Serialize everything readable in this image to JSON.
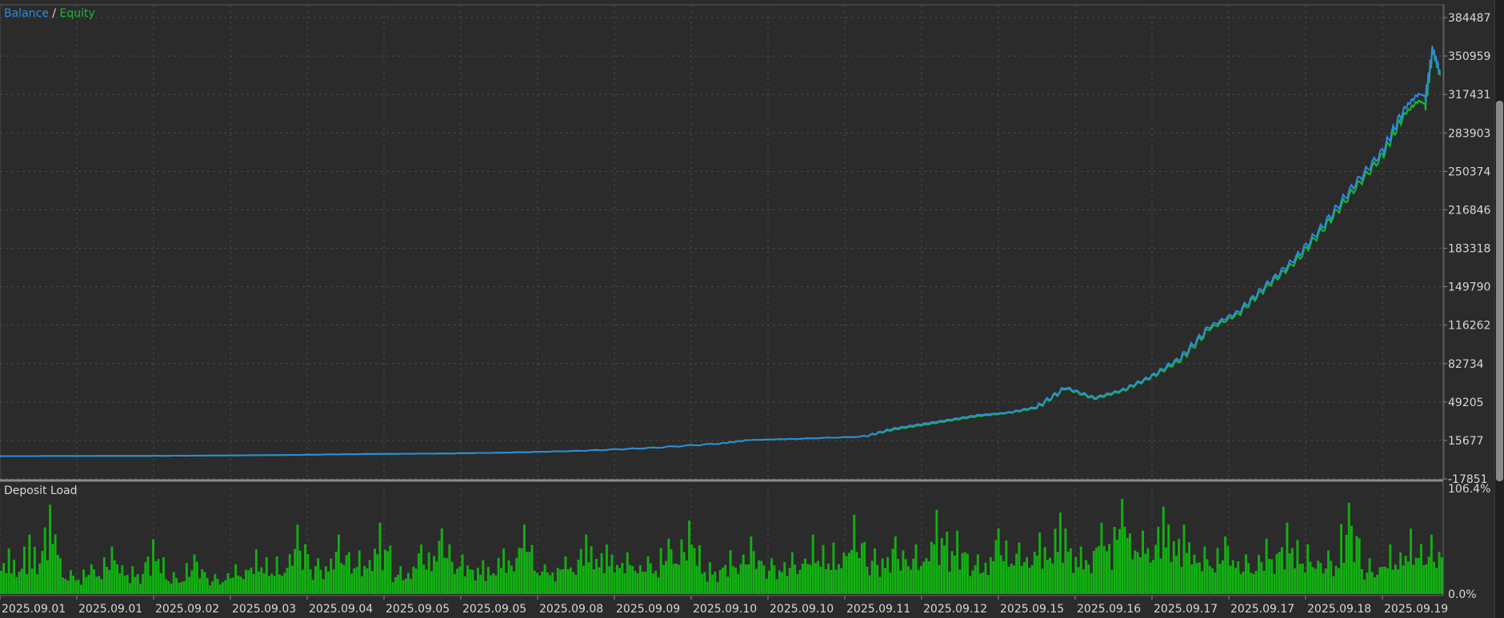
{
  "colors": {
    "background": "#2b2b2b",
    "grid": "#4a4a4a",
    "balance": "#2b8be0",
    "equity": "#19b832",
    "deposit_load": "#12b012",
    "text": "#d7d7d7"
  },
  "legend": {
    "balance_label": "Balance",
    "separator": "/",
    "equity_label": "Equity"
  },
  "subpanel": {
    "title": "Deposit Load"
  },
  "chart_data": [
    {
      "type": "line",
      "grid": true,
      "yticks": [
        "384487",
        "350959",
        "317431",
        "283903",
        "250374",
        "216846",
        "183318",
        "149790",
        "116262",
        "82734",
        "49205",
        "15677",
        "-17851"
      ],
      "ylim": [
        -17851,
        384487
      ],
      "series": [
        {
          "name": "Balance",
          "x": [
            0,
            0.05,
            0.1,
            0.15,
            0.2,
            0.25,
            0.3,
            0.35,
            0.4,
            0.45,
            0.5,
            0.52,
            0.55,
            0.6,
            0.62,
            0.64,
            0.66,
            0.68,
            0.7,
            0.72,
            0.74,
            0.76,
            0.78,
            0.8,
            0.82,
            0.84,
            0.86,
            0.88,
            0.9,
            0.92,
            0.94,
            0.96,
            0.975,
            0.985,
            0.99,
            0.995,
            1.0
          ],
          "values": [
            2000,
            2100,
            2200,
            2500,
            3000,
            3800,
            4200,
            5000,
            6500,
            9000,
            13000,
            16000,
            17000,
            19000,
            26000,
            30000,
            34000,
            38000,
            40000,
            45000,
            62000,
            53000,
            60000,
            72000,
            88000,
            115000,
            128000,
            152000,
            175000,
            205000,
            238000,
            268000,
            305000,
            318000,
            316000,
            358000,
            336000
          ]
        },
        {
          "name": "Equity",
          "x": [
            0,
            0.05,
            0.1,
            0.15,
            0.2,
            0.25,
            0.3,
            0.35,
            0.4,
            0.45,
            0.5,
            0.52,
            0.55,
            0.6,
            0.62,
            0.64,
            0.66,
            0.68,
            0.7,
            0.72,
            0.74,
            0.76,
            0.78,
            0.8,
            0.82,
            0.84,
            0.86,
            0.88,
            0.9,
            0.92,
            0.94,
            0.96,
            0.975,
            0.985,
            0.99,
            0.995,
            1.0
          ],
          "values": [
            2000,
            2100,
            2200,
            2500,
            3000,
            3800,
            4200,
            5000,
            6500,
            9000,
            13000,
            16000,
            17000,
            19000,
            25000,
            29000,
            33000,
            37000,
            39500,
            44000,
            61000,
            52000,
            59000,
            71000,
            86000,
            113000,
            126000,
            150000,
            172000,
            202000,
            234000,
            264000,
            300000,
            312000,
            309000,
            356000,
            334000
          ]
        }
      ]
    },
    {
      "type": "bar",
      "title": "Deposit Load",
      "yticks": [
        "106.4%",
        "0.0%"
      ],
      "ylim": [
        0,
        106.4
      ],
      "categories": [
        "2025.09.01",
        "2025.09.01",
        "2025.09.02",
        "2025.09.03",
        "2025.09.04",
        "2025.09.05",
        "2025.09.05",
        "2025.09.08",
        "2025.09.09",
        "2025.09.10",
        "2025.09.10",
        "2025.09.11",
        "2025.09.12",
        "2025.09.15",
        "2025.09.16",
        "2025.09.17",
        "2025.09.17",
        "2025.09.18",
        "2025.09.19"
      ],
      "series": [
        {
          "values": [
            46,
            60,
            90,
            24,
            30,
            48,
            28,
            55,
            22,
            40,
            20,
            30,
            45,
            38,
            70,
            36,
            60,
            44,
            72,
            28,
            50,
            66,
            40,
            34,
            46,
            70,
            30,
            38,
            60,
            50,
            42,
            38,
            56,
            74,
            32,
            44,
            58,
            36,
            42,
            60,
            52,
            80,
            46,
            58,
            50,
            85,
            64,
            40,
            66,
            52,
            62,
            82,
            48,
            72,
            96,
            64,
            88,
            70,
            48,
            58,
            40,
            56,
            72,
            50,
            44,
            92,
            36,
            50,
            66,
            60
          ]
        },
        {
          "values": [
            10,
            14,
            22,
            8,
            12,
            16,
            10,
            18,
            8,
            14,
            8,
            12,
            16,
            12,
            22,
            14,
            20,
            16,
            22,
            10,
            18,
            22,
            14,
            12,
            16,
            22,
            12,
            14,
            20,
            18,
            16,
            14,
            20,
            24,
            12,
            16,
            20,
            14,
            16,
            20,
            18,
            26,
            16,
            20,
            18,
            28,
            22,
            14,
            22,
            18,
            20,
            26,
            16,
            24,
            30,
            22,
            28,
            24,
            16,
            20,
            14,
            18,
            24,
            18,
            16,
            30,
            12,
            18,
            22,
            20
          ]
        }
      ]
    }
  ],
  "xaxis": {
    "labels": [
      "2025.09.01",
      "2025.09.01",
      "2025.09.02",
      "2025.09.03",
      "2025.09.04",
      "2025.09.05",
      "2025.09.05",
      "2025.09.08",
      "2025.09.09",
      "2025.09.10",
      "2025.09.10",
      "2025.09.11",
      "2025.09.12",
      "2025.09.15",
      "2025.09.16",
      "2025.09.17",
      "2025.09.17",
      "2025.09.18",
      "2025.09.19"
    ]
  }
}
